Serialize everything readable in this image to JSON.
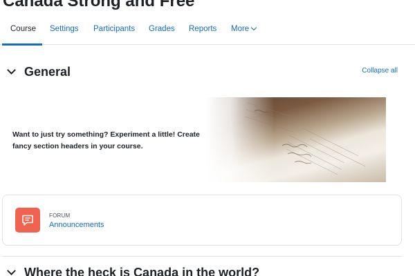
{
  "course": {
    "title": "Canada Strong and Free"
  },
  "tabs": [
    {
      "label": "Course"
    },
    {
      "label": "Settings"
    },
    {
      "label": "Participants"
    },
    {
      "label": "Grades"
    },
    {
      "label": "Reports"
    },
    {
      "label": "More"
    }
  ],
  "sections": [
    {
      "title": "General"
    },
    {
      "title": "Where the heck is Canada in the world?"
    }
  ],
  "collapse_all": "Collapse all",
  "banner": {
    "text": "Want to just try something? Experiment a little! Create fancy section headers in your course."
  },
  "activity": {
    "type": "FORUM",
    "name": "Announcements",
    "icon": "forum-icon",
    "icon_color": "#f0634f"
  },
  "colors": {
    "accent": "#0f6cbf",
    "text": "#1d2125"
  }
}
